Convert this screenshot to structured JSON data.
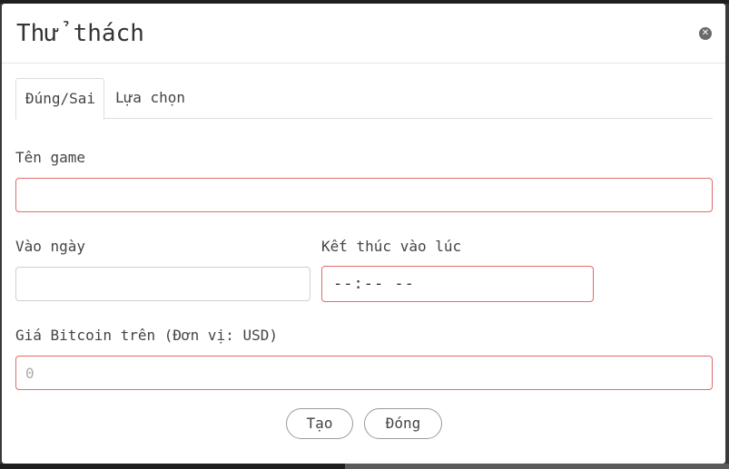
{
  "modal": {
    "title": "Thử thách",
    "close_icon": "close-icon"
  },
  "tabs": [
    {
      "label": "Đúng/Sai",
      "active": true
    },
    {
      "label": "Lựa chọn",
      "active": false
    }
  ],
  "form": {
    "game_name": {
      "label": "Tên game",
      "value": "",
      "placeholder": ""
    },
    "date": {
      "label": "Vào ngày",
      "value": "",
      "placeholder": ""
    },
    "end_time": {
      "label": "Kết thúc vào lúc",
      "value": "--:-- --"
    },
    "bitcoin_price": {
      "label": "Giá Bitcoin trên (Đơn vị: USD)",
      "value": "",
      "placeholder": "0"
    }
  },
  "buttons": {
    "create": "Tạo",
    "close": "Đóng"
  },
  "colors": {
    "invalid_border": "#e26b6b",
    "neutral_border": "#cfcfcf"
  }
}
